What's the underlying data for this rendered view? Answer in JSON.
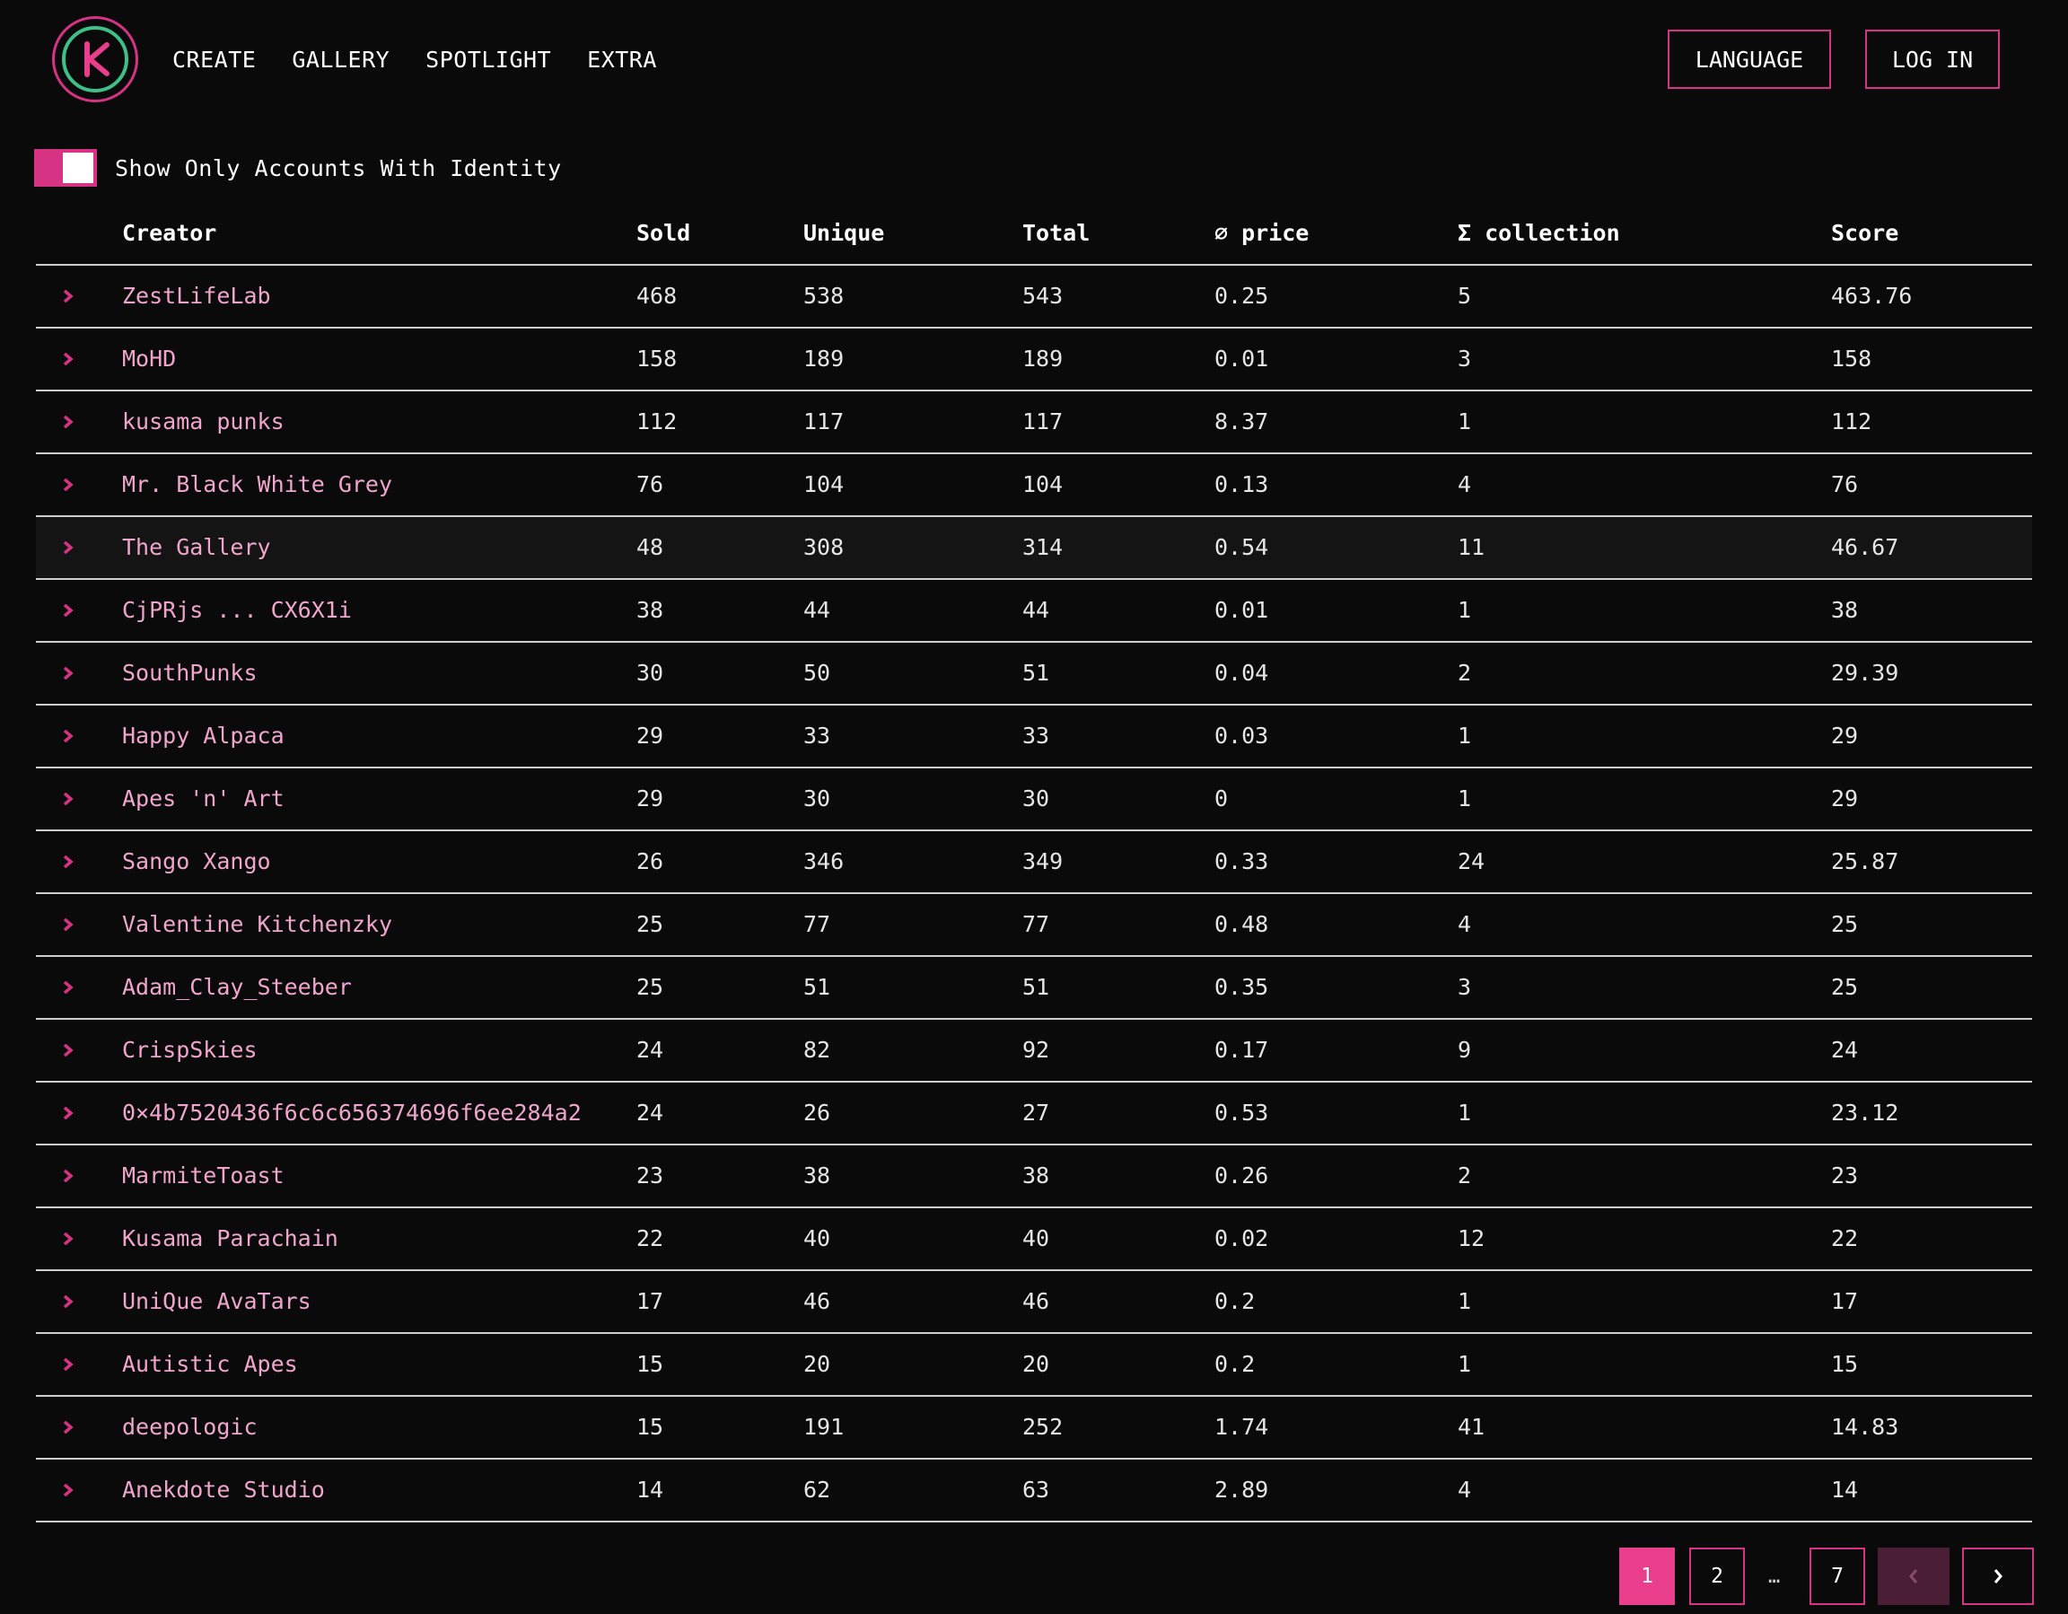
{
  "colors": {
    "background": "#0a0a0a",
    "accent": "#d63384",
    "accent_active": "#e83e8c",
    "creator_text": "#f0a6cc",
    "logo_ring": "#3fbf8a"
  },
  "nav": {
    "logo_icon": "kodadot-logo-icon",
    "links": [
      "CREATE",
      "GALLERY",
      "SPOTLIGHT",
      "EXTRA"
    ],
    "language_label": "LANGUAGE",
    "login_label": "LOG IN"
  },
  "filter": {
    "toggle_on": true,
    "label": "Show Only Accounts With Identity"
  },
  "table": {
    "headers": {
      "creator": "Creator",
      "sold": "Sold",
      "unique": "Unique",
      "total": "Total",
      "price": "∅ price",
      "collection": "Σ collection",
      "score": "Score"
    },
    "rows": [
      {
        "creator": "ZestLifeLab",
        "sold": "468",
        "unique": "538",
        "total": "543",
        "price": "0.25",
        "collection": "5",
        "score": "463.76"
      },
      {
        "creator": "MoHD",
        "sold": "158",
        "unique": "189",
        "total": "189",
        "price": "0.01",
        "collection": "3",
        "score": "158"
      },
      {
        "creator": "kusama punks",
        "sold": "112",
        "unique": "117",
        "total": "117",
        "price": "8.37",
        "collection": "1",
        "score": "112"
      },
      {
        "creator": "Mr. Black White Grey",
        "sold": "76",
        "unique": "104",
        "total": "104",
        "price": "0.13",
        "collection": "4",
        "score": "76"
      },
      {
        "creator": "The Gallery",
        "sold": "48",
        "unique": "308",
        "total": "314",
        "price": "0.54",
        "collection": "11",
        "score": "46.67"
      },
      {
        "creator": "CjPRjs ... CX6X1i",
        "sold": "38",
        "unique": "44",
        "total": "44",
        "price": "0.01",
        "collection": "1",
        "score": "38"
      },
      {
        "creator": "SouthPunks",
        "sold": "30",
        "unique": "50",
        "total": "51",
        "price": "0.04",
        "collection": "2",
        "score": "29.39"
      },
      {
        "creator": "Happy Alpaca",
        "sold": "29",
        "unique": "33",
        "total": "33",
        "price": "0.03",
        "collection": "1",
        "score": "29"
      },
      {
        "creator": "Apes 'n' Art",
        "sold": "29",
        "unique": "30",
        "total": "30",
        "price": "0",
        "collection": "1",
        "score": "29"
      },
      {
        "creator": "Sango Xango",
        "sold": "26",
        "unique": "346",
        "total": "349",
        "price": "0.33",
        "collection": "24",
        "score": "25.87"
      },
      {
        "creator": "Valentine Kitchenzky",
        "sold": "25",
        "unique": "77",
        "total": "77",
        "price": "0.48",
        "collection": "4",
        "score": "25"
      },
      {
        "creator": "Adam_Clay_Steeber",
        "sold": "25",
        "unique": "51",
        "total": "51",
        "price": "0.35",
        "collection": "3",
        "score": "25"
      },
      {
        "creator": "CrispSkies",
        "sold": "24",
        "unique": "82",
        "total": "92",
        "price": "0.17",
        "collection": "9",
        "score": "24"
      },
      {
        "creator": "0×4b7520436f6c6c656374696f6ee284a2",
        "sold": "24",
        "unique": "26",
        "total": "27",
        "price": "0.53",
        "collection": "1",
        "score": "23.12"
      },
      {
        "creator": "MarmiteToast",
        "sold": "23",
        "unique": "38",
        "total": "38",
        "price": "0.26",
        "collection": "2",
        "score": "23"
      },
      {
        "creator": "Kusama Parachain",
        "sold": "22",
        "unique": "40",
        "total": "40",
        "price": "0.02",
        "collection": "12",
        "score": "22"
      },
      {
        "creator": "UniQue AvaTars",
        "sold": "17",
        "unique": "46",
        "total": "46",
        "price": "0.2",
        "collection": "1",
        "score": "17"
      },
      {
        "creator": "Autistic Apes",
        "sold": "15",
        "unique": "20",
        "total": "20",
        "price": "0.2",
        "collection": "1",
        "score": "15"
      },
      {
        "creator": "deepologic",
        "sold": "15",
        "unique": "191",
        "total": "252",
        "price": "1.74",
        "collection": "41",
        "score": "14.83"
      },
      {
        "creator": "Anekdote Studio",
        "sold": "14",
        "unique": "62",
        "total": "63",
        "price": "2.89",
        "collection": "4",
        "score": "14"
      }
    ],
    "highlighted_row": 4
  },
  "pagination": {
    "pages": [
      "1",
      "2",
      "7"
    ],
    "current": "1",
    "ellipsis": "…",
    "prev_icon": "chevron-left-icon",
    "next_icon": "chevron-right-icon"
  }
}
